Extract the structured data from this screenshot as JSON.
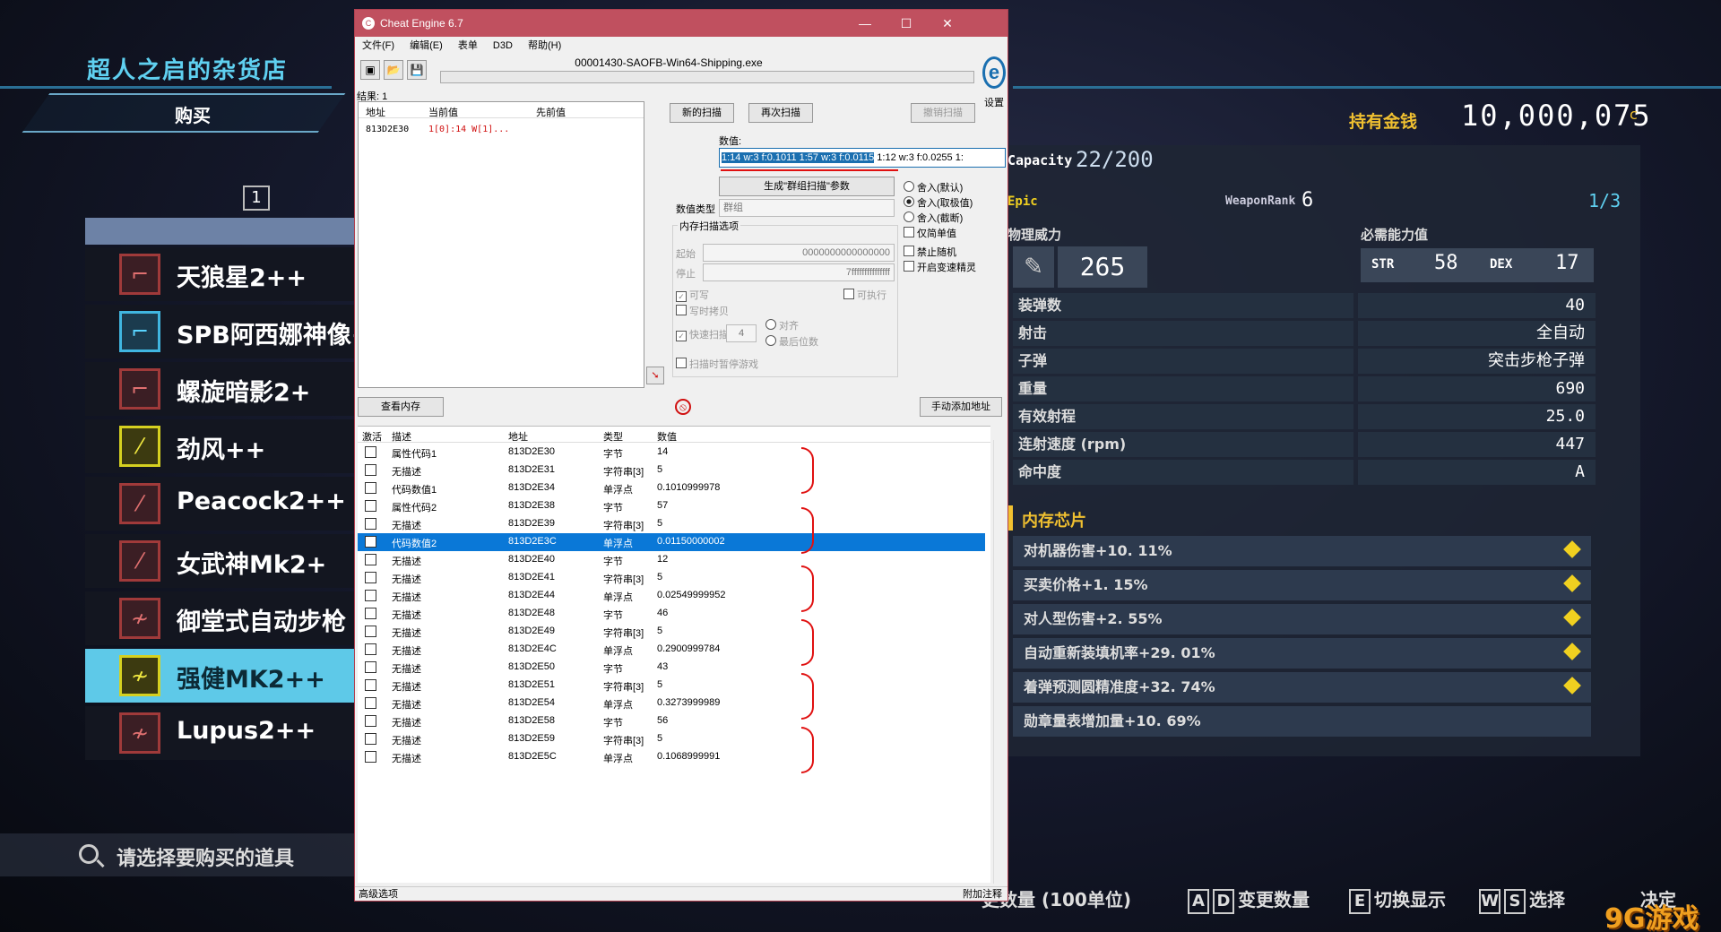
{
  "game": {
    "shop_title": "超人之启的杂货店",
    "buy_tab": "购买",
    "page_number": "1",
    "weapons": [
      {
        "name": "天狼星2++",
        "color": "red",
        "icon": "smg-icon"
      },
      {
        "name": "SPB阿西娜神像+",
        "color": "blue",
        "icon": "smg-icon"
      },
      {
        "name": "螺旋暗影2+",
        "color": "red",
        "icon": "smg-icon"
      },
      {
        "name": "劲风++",
        "color": "yellow",
        "icon": "sniper-icon"
      },
      {
        "name": "Peacock2++",
        "color": "red",
        "icon": "sniper-icon"
      },
      {
        "name": "女武神Mk2+",
        "color": "red",
        "icon": "sniper-icon"
      },
      {
        "name": "御堂式自动步枪",
        "color": "red",
        "icon": "rifle-icon"
      },
      {
        "name": "强健MK2++",
        "color": "yellow",
        "icon": "rifle-icon",
        "selected": true
      },
      {
        "name": "Lupus2++",
        "color": "red",
        "icon": "rifle-icon"
      }
    ],
    "search_prompt": "请选择要购买的道具",
    "gold_label": "持有金钱",
    "gold_value": "10,000,075",
    "gold_unit": "c",
    "capacity_label": "Capacity",
    "capacity_value": "22/200",
    "rarity": "Epic",
    "weapon_rank_label": "WeaponRank",
    "weapon_rank_value": "6",
    "page_indicator": "1/3",
    "power_label": "物理威力",
    "power_value": "265",
    "req_label": "必需能力值",
    "str_label": "STR",
    "str_value": "58",
    "dex_label": "DEX",
    "dex_value": "17",
    "stats": [
      {
        "label": "装弹数",
        "value": "40"
      },
      {
        "label": "射击",
        "value": "全自动"
      },
      {
        "label": "子弹",
        "value": "突击步枪子弹"
      },
      {
        "label": "重量",
        "value": "690"
      },
      {
        "label": "有效射程",
        "value": "25.0"
      },
      {
        "label": "连射速度 (rpm)",
        "value": "447"
      },
      {
        "label": "命中度",
        "value": "A"
      }
    ],
    "chips_title": "内存芯片",
    "chips": [
      "对机器伤害+10. 11%",
      "买卖价格+1. 15%",
      "对人型伤害+2. 55%",
      "自动重新装填机率+29. 01%",
      "着弹预测圆精准度+32. 74%",
      "勋章量表增加量+10. 69%"
    ],
    "hints": {
      "qty": "更数量 (100单位)",
      "a_key": "A",
      "d_key": "D",
      "change_qty": "变更数量",
      "e_key": "E",
      "toggle_display": "切换显示",
      "w_key": "W",
      "s_key": "S",
      "select": "选择",
      "confirm": "决定"
    },
    "watermark": "9G游戏"
  },
  "ce": {
    "title": "Cheat Engine 6.7",
    "menu": [
      "文件(F)",
      "编辑(E)",
      "表单",
      "D3D",
      "帮助(H)"
    ],
    "process": "00001430-SAOFB-Win64-Shipping.exe",
    "settings": "设置",
    "results": "结果: 1",
    "found_headers": [
      "地址",
      "当前值",
      "先前值"
    ],
    "found_row": {
      "address": "813D2E30",
      "value": "1[0]:14 W[1]..."
    },
    "new_scan": "新的扫描",
    "next_scan": "再次扫描",
    "undo_scan": "撤销扫描",
    "value_label": "数值:",
    "value_highlight": "1:14 w:3 f:0.1011 1:57 w:3 f:0.0115",
    "value_rest": " 1:12 w:3 f:0.0255 1:",
    "gen_group_btn": "生成\"群组扫描\"参数",
    "value_type_label": "数值类型",
    "value_type": "群组",
    "rounding": [
      "舍入(默认)",
      "舍入(取极值)",
      "舍入(截断)"
    ],
    "simple_values": "仅简单值",
    "memory_options": "内存扫描选项",
    "start_label": "起始",
    "start_value": "0000000000000000",
    "stop_label": "停止",
    "stop_value": "7fffffffffffffff",
    "writable": "可写",
    "executable": "可执行",
    "copy_on_write": "写时拷贝",
    "fast_scan": "快速扫描",
    "fast_value": "4",
    "align": "对齐",
    "last_digits": "最后位数",
    "pause_game": "扫描时暂停游戏",
    "no_random": "禁止随机",
    "speedhack": "开启变速精灵",
    "view_memory": "查看内存",
    "add_manually": "手动添加地址",
    "table_headers": [
      "激活",
      "描述",
      "地址",
      "类型",
      "数值"
    ],
    "rows": [
      {
        "desc": "属性代码1",
        "addr": "813D2E30",
        "type": "字节",
        "val": "14"
      },
      {
        "desc": "无描述",
        "addr": "813D2E31",
        "type": "字符串[3]",
        "val": "5"
      },
      {
        "desc": "代码数值1",
        "addr": "813D2E34",
        "type": "单浮点",
        "val": "0.1010999978"
      },
      {
        "desc": "属性代码2",
        "addr": "813D2E38",
        "type": "字节",
        "val": "57"
      },
      {
        "desc": "无描述",
        "addr": "813D2E39",
        "type": "字符串[3]",
        "val": "5"
      },
      {
        "desc": "代码数值2",
        "addr": "813D2E3C",
        "type": "单浮点",
        "val": "0.01150000002"
      },
      {
        "desc": "无描述",
        "addr": "813D2E40",
        "type": "字节",
        "val": "12"
      },
      {
        "desc": "无描述",
        "addr": "813D2E41",
        "type": "字符串[3]",
        "val": "5"
      },
      {
        "desc": "无描述",
        "addr": "813D2E44",
        "type": "单浮点",
        "val": "0.02549999952"
      },
      {
        "desc": "无描述",
        "addr": "813D2E48",
        "type": "字节",
        "val": "46"
      },
      {
        "desc": "无描述",
        "addr": "813D2E49",
        "type": "字符串[3]",
        "val": "5"
      },
      {
        "desc": "无描述",
        "addr": "813D2E4C",
        "type": "单浮点",
        "val": "0.2900999784"
      },
      {
        "desc": "无描述",
        "addr": "813D2E50",
        "type": "字节",
        "val": "43"
      },
      {
        "desc": "无描述",
        "addr": "813D2E51",
        "type": "字符串[3]",
        "val": "5"
      },
      {
        "desc": "无描述",
        "addr": "813D2E54",
        "type": "单浮点",
        "val": "0.3273999989"
      },
      {
        "desc": "无描述",
        "addr": "813D2E58",
        "type": "字节",
        "val": "56"
      },
      {
        "desc": "无描述",
        "addr": "813D2E59",
        "type": "字符串[3]",
        "val": "5"
      },
      {
        "desc": "无描述",
        "addr": "813D2E5C",
        "type": "单浮点",
        "val": "0.1068999991"
      }
    ],
    "selected_row": 5,
    "advanced": "高级选项",
    "comments": "附加注释"
  }
}
